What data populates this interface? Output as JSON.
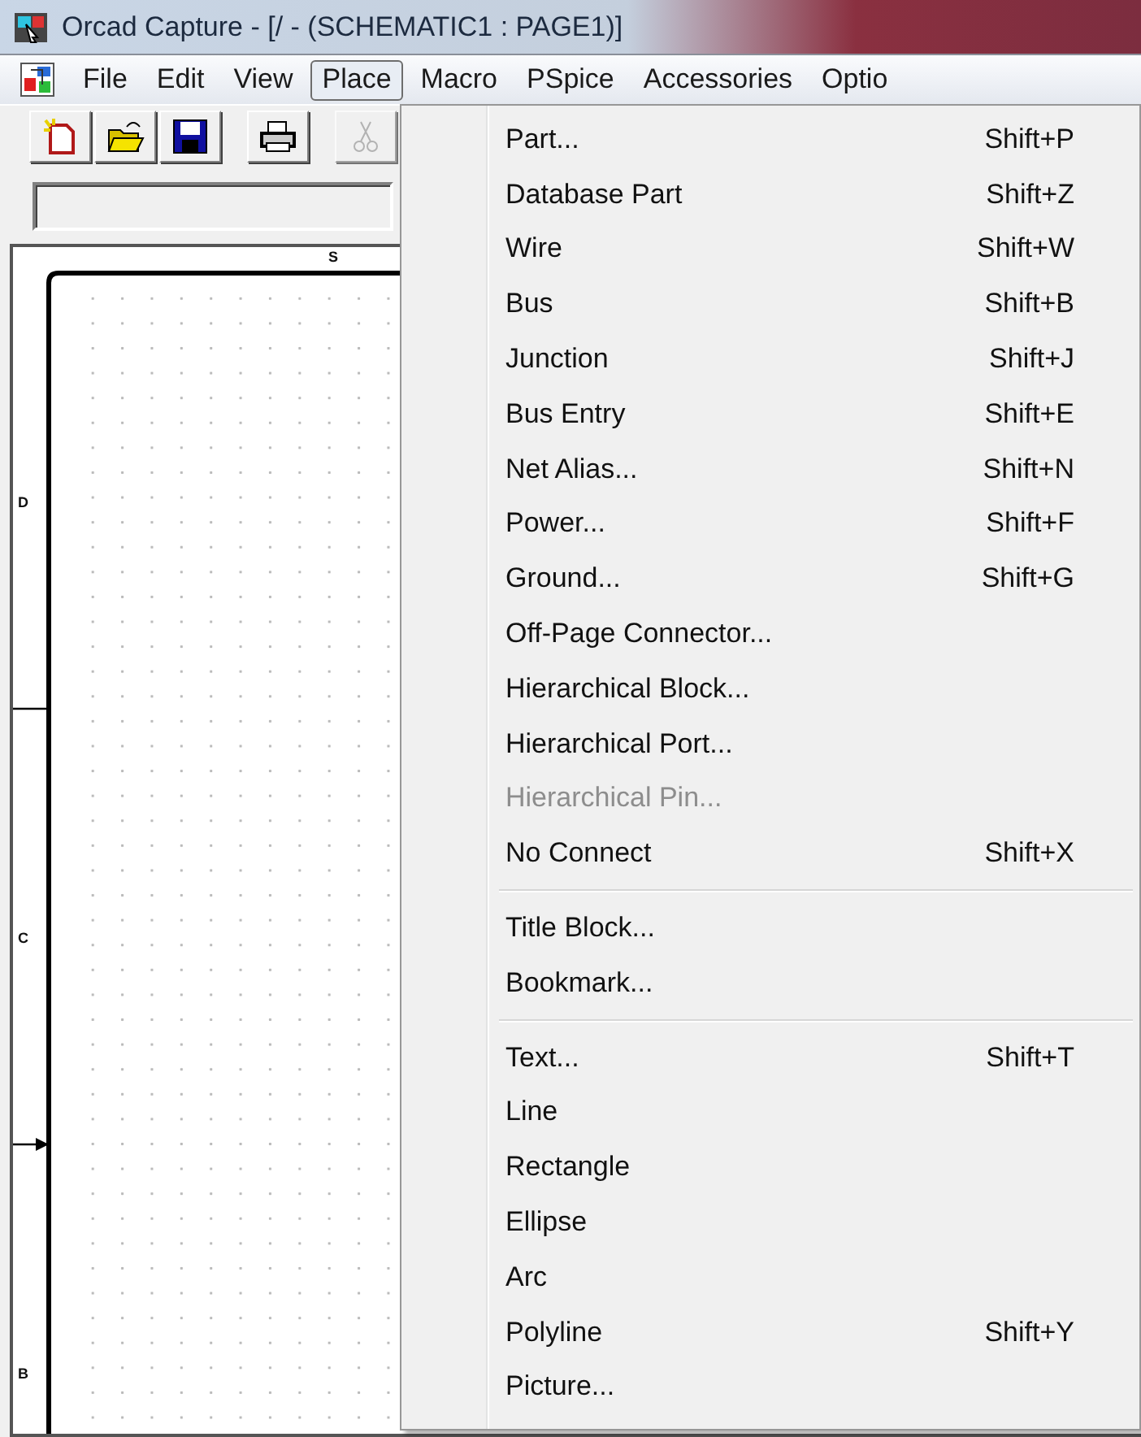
{
  "window": {
    "title": "Orcad Capture - [/ - (SCHEMATIC1 : PAGE1)]"
  },
  "menu_bar": [
    {
      "label": "File",
      "selected": false
    },
    {
      "label": "Edit",
      "selected": false
    },
    {
      "label": "View",
      "selected": false
    },
    {
      "label": "Place",
      "selected": true
    },
    {
      "label": "Macro",
      "selected": false
    },
    {
      "label": "PSpice",
      "selected": false
    },
    {
      "label": "Accessories",
      "selected": false
    },
    {
      "label": "Optio",
      "selected": false
    }
  ],
  "toolbar": [
    {
      "kind": "new",
      "disabled": false
    },
    {
      "kind": "open",
      "disabled": false
    },
    {
      "kind": "save",
      "disabled": false
    },
    {
      "kind": "print",
      "disabled": false
    },
    {
      "kind": "cut",
      "disabled": true
    }
  ],
  "canvas": {
    "top_label": "S",
    "side_labels": [
      "D",
      "C",
      "B"
    ]
  },
  "place_menu": {
    "groups": [
      [
        {
          "label": "Part...",
          "shortcut": "Shift+P",
          "disabled": false
        },
        {
          "label": "Database Part",
          "shortcut": "Shift+Z",
          "disabled": false
        },
        {
          "label": "Wire",
          "shortcut": "Shift+W",
          "disabled": false
        },
        {
          "label": "Bus",
          "shortcut": "Shift+B",
          "disabled": false
        },
        {
          "label": "Junction",
          "shortcut": "Shift+J",
          "disabled": false
        },
        {
          "label": "Bus Entry",
          "shortcut": "Shift+E",
          "disabled": false
        },
        {
          "label": "Net Alias...",
          "shortcut": "Shift+N",
          "disabled": false
        },
        {
          "label": "Power...",
          "shortcut": "Shift+F",
          "disabled": false
        },
        {
          "label": "Ground...",
          "shortcut": "Shift+G",
          "disabled": false
        },
        {
          "label": "Off-Page Connector...",
          "disabled": false
        },
        {
          "label": "Hierarchical Block...",
          "disabled": false
        },
        {
          "label": "Hierarchical Port...",
          "disabled": false
        },
        {
          "label": "Hierarchical Pin...",
          "disabled": true
        },
        {
          "label": "No Connect",
          "shortcut": "Shift+X",
          "disabled": false
        }
      ],
      [
        {
          "label": "Title Block...",
          "disabled": false
        },
        {
          "label": "Bookmark...",
          "disabled": false
        }
      ],
      [
        {
          "label": "Text...",
          "shortcut": "Shift+T",
          "disabled": false
        },
        {
          "label": "Line",
          "disabled": false
        },
        {
          "label": "Rectangle",
          "disabled": false
        },
        {
          "label": "Ellipse",
          "disabled": false
        },
        {
          "label": "Arc",
          "disabled": false
        },
        {
          "label": "Polyline",
          "shortcut": "Shift+Y",
          "disabled": false
        },
        {
          "label": "Picture...",
          "disabled": false
        }
      ]
    ]
  }
}
